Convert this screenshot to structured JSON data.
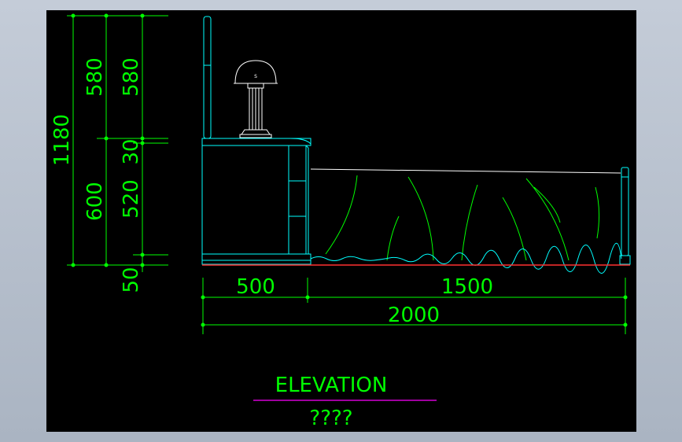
{
  "drawing": {
    "colors": {
      "background": "#000000",
      "viewport_border": "#aab4c2",
      "dimension": "#00ff00",
      "furniture": "#00ffff",
      "lamp": "#ffffff",
      "floor": "#ff0000",
      "title_underline": "#ff00ff",
      "folds": "#00ff00"
    },
    "dimensions": {
      "total_height": "1180",
      "upper_height": "580",
      "upper_height_inner": "580",
      "lower_height": "600",
      "top_rail": "30",
      "cabinet_height": "520",
      "plinth": "50",
      "nightstand_width": "500",
      "bed_width": "1500",
      "total_width": "2000"
    },
    "title": "ELEVATION",
    "subtitle": "????"
  }
}
